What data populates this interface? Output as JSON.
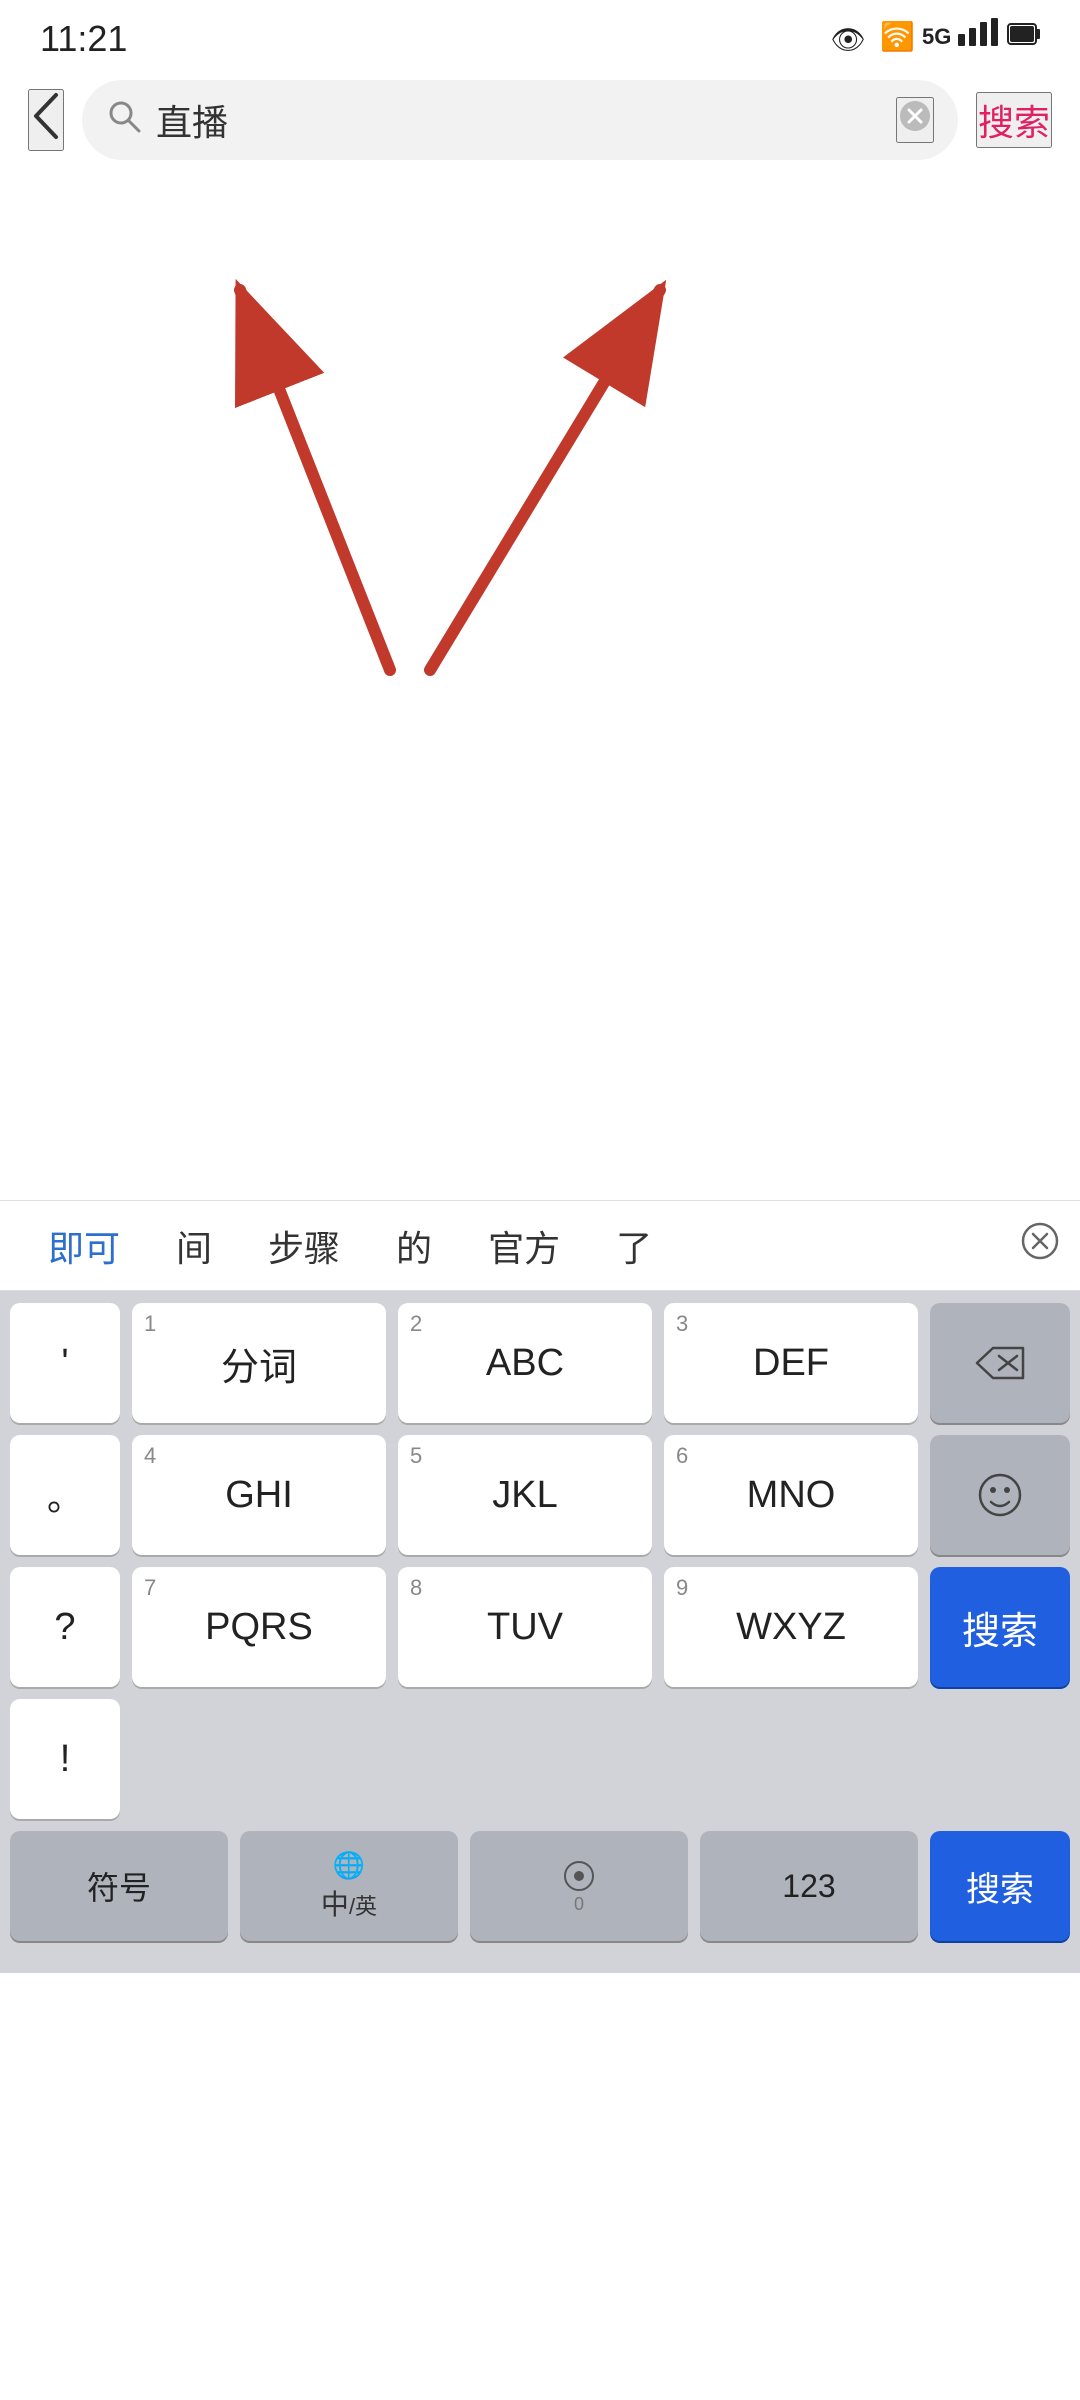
{
  "statusBar": {
    "time": "11:21",
    "icons": [
      "👁",
      "📶",
      "5G",
      "🔋"
    ]
  },
  "searchBar": {
    "back_label": "‹",
    "placeholder": "直播",
    "search_value": "直播",
    "clear_label": "✕",
    "action_label": "搜索"
  },
  "imeSuggestions": {
    "items": [
      "即可",
      "间",
      "步骤",
      "的",
      "官方",
      "了"
    ],
    "active_index": 0,
    "delete_label": "⊗"
  },
  "keyboard": {
    "rows": [
      [
        {
          "label": "分词",
          "number": "1"
        },
        {
          "label": "ABC",
          "number": "2"
        },
        {
          "label": "DEF",
          "number": "3"
        }
      ],
      [
        {
          "label": "GHI",
          "number": "4"
        },
        {
          "label": "JKL",
          "number": "5"
        },
        {
          "label": "MNO",
          "number": "6"
        }
      ],
      [
        {
          "label": "PQRS",
          "number": "7"
        },
        {
          "label": "TUV",
          "number": "8"
        },
        {
          "label": "WXYZ",
          "number": "9"
        }
      ]
    ],
    "symbol_keys": [
      "'",
      "。",
      "?",
      "!"
    ],
    "special_right_top": "⌫",
    "special_right_mid": "☺",
    "special_right_bot": "搜索",
    "bottom_row": [
      {
        "label": "符号",
        "sub": ""
      },
      {
        "label": "中",
        "sub": "/英"
      },
      {
        "label": "0",
        "sub": "🎤"
      },
      {
        "label": "123",
        "sub": ""
      }
    ]
  },
  "annotations": {
    "arrow1_label": "",
    "arrow2_label": ""
  }
}
